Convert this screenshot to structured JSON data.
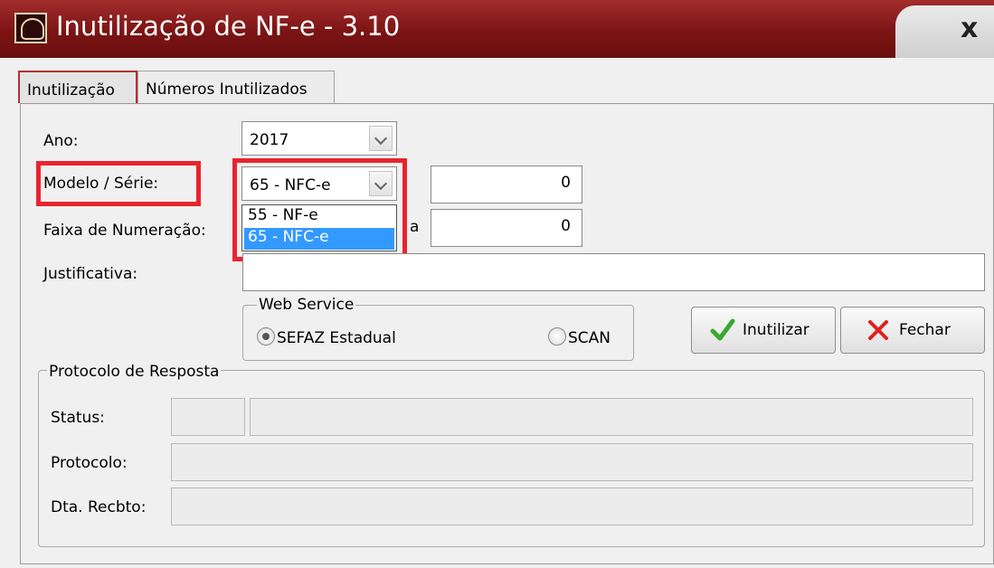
{
  "window": {
    "title": "Inutilização de NF-e - 3.10",
    "close_label": "x"
  },
  "tabs": [
    {
      "label": "Inutilização",
      "active": true
    },
    {
      "label": "Números Inutilizados",
      "active": false
    }
  ],
  "form": {
    "ano_label": "Ano:",
    "ano_value": "2017",
    "modelo_label": "Modelo / Série:",
    "modelo_value": "65 - NFC-e",
    "serie_value": "0",
    "faixa_label": "Faixa de Numeração:",
    "faixa_sep": "a",
    "faixa_fim": "0",
    "justificativa_label": "Justificativa:",
    "justificativa_value": ""
  },
  "dropdown": {
    "options": [
      "55 - NF-e",
      "65 - NFC-e"
    ],
    "selected_index": 1
  },
  "web_service": {
    "legend": "Web Service",
    "options": [
      "SEFAZ Estadual",
      "SCAN"
    ],
    "selected": "SEFAZ Estadual"
  },
  "buttons": {
    "inutilizar": "Inutilizar",
    "fechar": "Fechar"
  },
  "protocolo": {
    "legend": "Protocolo de Resposta",
    "status_label": "Status:",
    "protocolo_label": "Protocolo:",
    "dta_label": "Dta. Recbto:"
  },
  "colors": {
    "titlebar": "#8b1a1a",
    "highlight": "#e8242e",
    "selection": "#3399ff",
    "check_green": "#3aa832",
    "close_red": "#e02020"
  }
}
